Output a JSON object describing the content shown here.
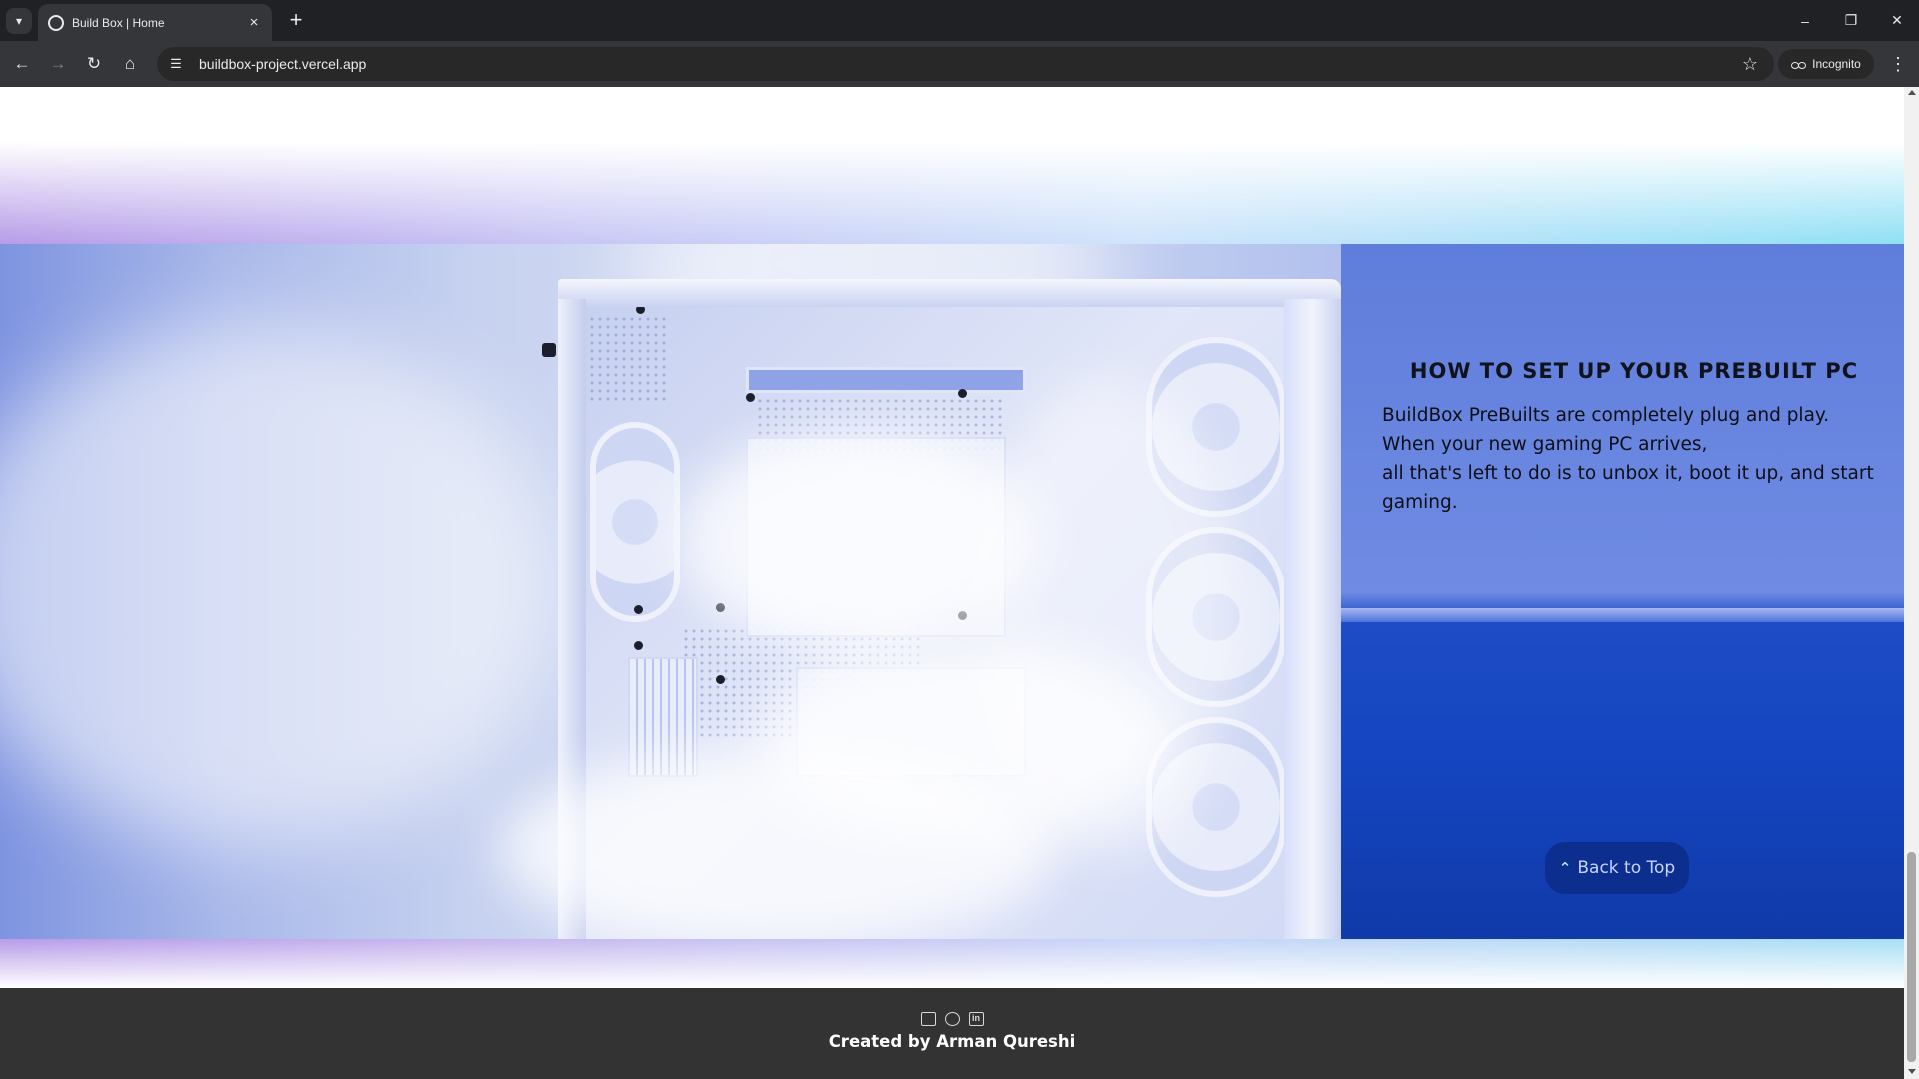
{
  "browser": {
    "tab_title": "Build Box | Home",
    "url": "buildbox-project.vercel.app",
    "incognito_label": "Incognito"
  },
  "icons": {
    "tab_list": "chevron-down-icon",
    "favicon": "globe-icon",
    "tab_close": "close-icon",
    "new_tab": "plus-icon",
    "back": "arrow-left-icon",
    "forward": "arrow-right-icon",
    "reload": "reload-icon",
    "home": "home-icon",
    "site_info": "tune-icon",
    "bookmark": "star-icon",
    "menu": "kebab-menu-icon",
    "footer": [
      "mail-icon",
      "github-icon",
      "linkedin-icon"
    ]
  },
  "section": {
    "title": "HOW TO SET UP YOUR PREBUILT PC",
    "paragraph_lines": [
      "BuildBox PreBuilts are completely plug and play.",
      "When your new gaming PC arrives,",
      "all that's left to do is to unbox it, boot it up, and start gaming."
    ],
    "back_to_top": "Back to Top"
  },
  "footer": {
    "credit": "Created by Arman Qureshi"
  },
  "colors": {
    "browser_frame": "#202124",
    "toolbar": "#35363a",
    "back_to_top_bg": "#0c2f8f",
    "footer_bg": "#333333",
    "shelf_blue": "#1444c0"
  }
}
